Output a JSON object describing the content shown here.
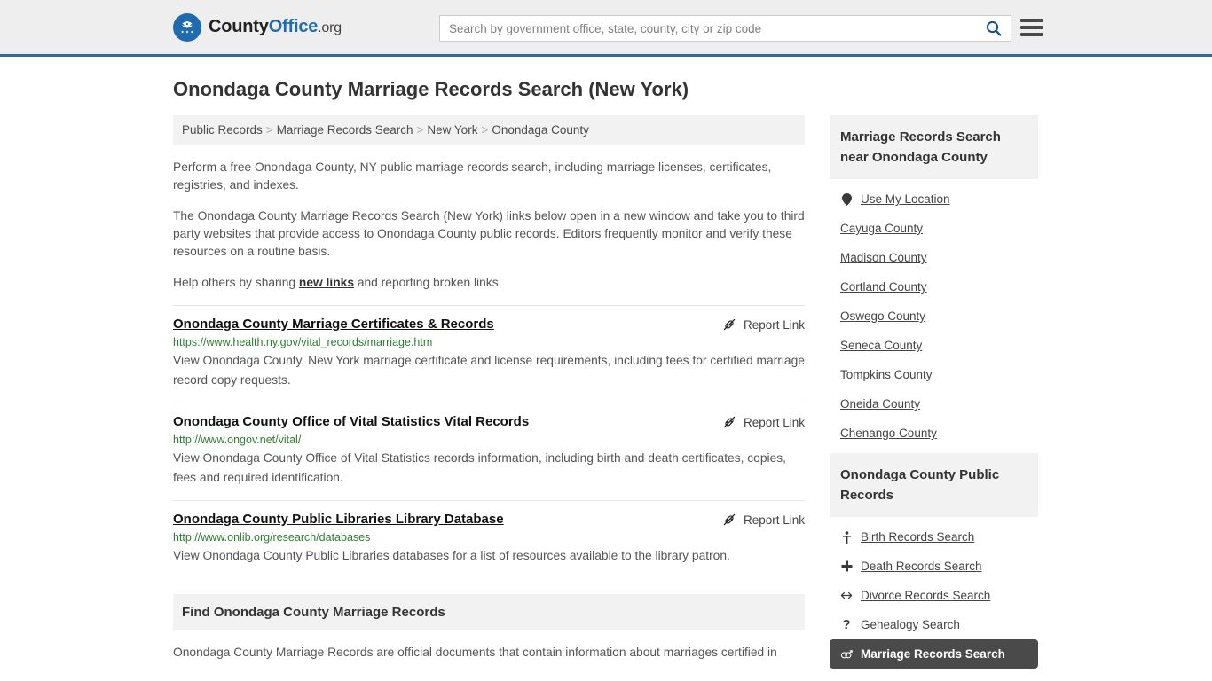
{
  "header": {
    "logo": {
      "part1": "County",
      "part2": "Office",
      "part3": ".org",
      "icon": "eagle-seal-icon"
    },
    "search": {
      "placeholder": "Search by government office, state, county, city or zip code",
      "value": ""
    },
    "search_icon": "search-icon",
    "menu_icon": "hamburger-menu-icon",
    "accent_color": "#33699f",
    "bg_color": "#eeeeee"
  },
  "page": {
    "title": "Onondaga County Marriage Records Search (New York)"
  },
  "breadcrumb": {
    "items": [
      "Public Records",
      "Marriage Records Search",
      "New York",
      "Onondaga County"
    ],
    "separator": ">"
  },
  "intro": {
    "p1": "Perform a free Onondaga County, NY public marriage records search, including marriage licenses, certificates, registries, and indexes.",
    "p2": "The Onondaga County Marriage Records Search (New York) links below open in a new window and take you to third party websites that provide access to Onondaga County public records. Editors frequently monitor and verify these resources on a routine basis.",
    "p3_before": "Help others by sharing ",
    "p3_link": "new links",
    "p3_after": " and reporting broken links."
  },
  "results": {
    "report_label": "Report Link",
    "report_icon": "broken-link-icon",
    "url_color": "#2e7d32",
    "items": [
      {
        "title": "Onondaga County Marriage Certificates & Records",
        "url": "https://www.health.ny.gov/vital_records/marriage.htm",
        "description": "View Onondaga County, New York marriage certificate and license requirements, including fees for certified marriage record copy requests."
      },
      {
        "title": "Onondaga County Office of Vital Statistics Vital Records",
        "url": "http://www.ongov.net/vital/",
        "description": "View Onondaga County Office of Vital Statistics records information, including birth and death certificates, copies, fees and required identification."
      },
      {
        "title": "Onondaga County Public Libraries Library Database",
        "url": "http://www.onlib.org/research/databases",
        "description": "View Onondaga County Public Libraries databases for a list of resources available to the library patron."
      }
    ]
  },
  "find_section": {
    "heading": "Find Onondaga County Marriage Records",
    "body": "Onondaga County Marriage Records are official documents that contain information about marriages certified in"
  },
  "sidebar": {
    "nearby": {
      "heading": "Marriage Records Search near Onondaga County",
      "use_my_location": {
        "label": "Use My Location",
        "icon": "map-pin-icon"
      },
      "counties": [
        "Cayuga County",
        "Madison County",
        "Cortland County",
        "Oswego County",
        "Seneca County",
        "Tompkins County",
        "Oneida County",
        "Chenango County"
      ]
    },
    "public_records": {
      "heading": "Onondaga County Public Records",
      "items": [
        {
          "label": "Birth Records Search",
          "icon": "baby-icon",
          "glyph": "Ɣ",
          "active": false
        },
        {
          "label": "Death Records Search",
          "icon": "cross-icon",
          "glyph": "✚",
          "active": false
        },
        {
          "label": "Divorce Records Search",
          "icon": "split-arrows-icon",
          "glyph": "↔",
          "active": false
        },
        {
          "label": "Genealogy Search",
          "icon": "question-mark-icon",
          "glyph": "?",
          "active": false
        },
        {
          "label": "Marriage Records Search",
          "icon": "interlocking-rings-icon",
          "glyph": "⚥",
          "active": true
        }
      ],
      "active_bg": "#4a4a4a"
    }
  }
}
